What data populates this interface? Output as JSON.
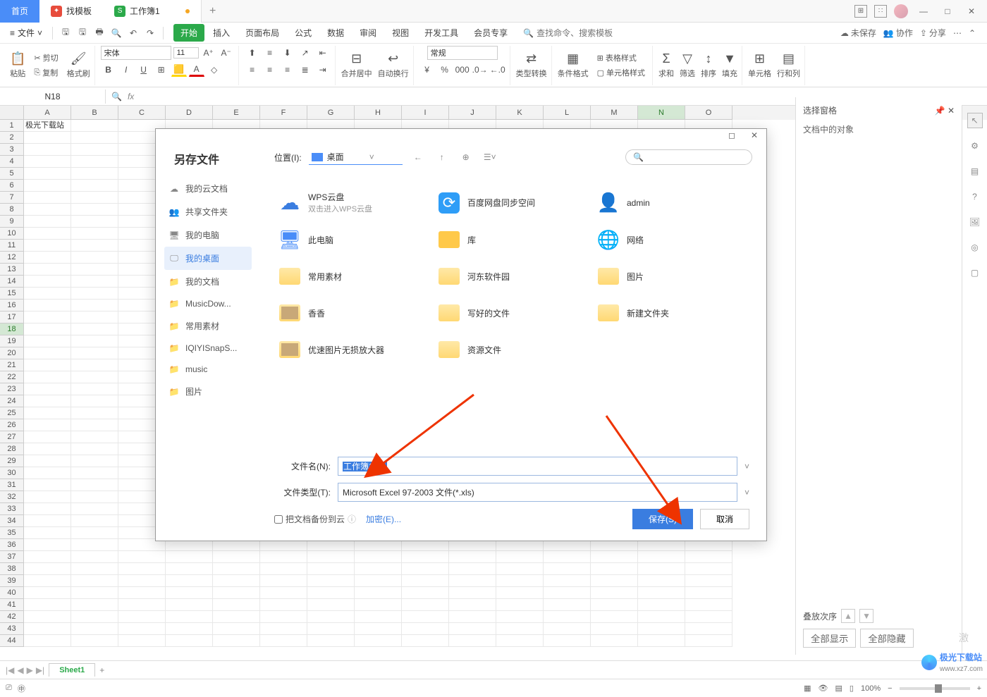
{
  "titleTabs": {
    "home": "首页",
    "template": "找模板",
    "workbook": "工作簿1"
  },
  "menu": {
    "file": "文件",
    "tabs": [
      "开始",
      "插入",
      "页面布局",
      "公式",
      "数据",
      "审阅",
      "视图",
      "开发工具",
      "会员专享"
    ],
    "searchPlaceholder": "查找命令、搜索模板",
    "unsaved": "未保存",
    "coop": "协作",
    "share": "分享"
  },
  "ribbon": {
    "paste": "粘贴",
    "cut": "剪切",
    "copy": "复制",
    "fmtPainter": "格式刷",
    "font": "宋体",
    "fontSize": "11",
    "mergeCenter": "合并居中",
    "wrap": "自动换行",
    "general": "常规",
    "typeConvert": "类型转换",
    "condFmt": "条件格式",
    "tableStyle": "表格样式",
    "cellStyle": "单元格样式",
    "sum": "求和",
    "filter": "筛选",
    "sort": "排序",
    "fill": "填充",
    "cells": "单元格",
    "rowsCols": "行和列"
  },
  "nameBox": "N18",
  "cellA1": "极光下载站",
  "columns": [
    "A",
    "B",
    "C",
    "D",
    "E",
    "F",
    "G",
    "H",
    "I",
    "J",
    "K",
    "L",
    "M",
    "N",
    "O"
  ],
  "activeCol": "N",
  "activeRow": 18,
  "sheetTab": "Sheet1",
  "sidePanel": {
    "title": "选择窗格",
    "objects": "文档中的对象",
    "stack": "叠放次序",
    "showAll": "全部显示",
    "hideAll": "全部隐藏"
  },
  "status": {
    "zoom": "100%"
  },
  "dialog": {
    "title": "另存文件",
    "locationLabel": "位置(I):",
    "locationValue": "桌面",
    "sidebar": [
      "我的云文档",
      "共享文件夹",
      "我的电脑",
      "我的桌面",
      "我的文档",
      "MusicDow...",
      "常用素材",
      "IQIYISnapS...",
      "music",
      "图片"
    ],
    "sidebarActive": 3,
    "files": [
      {
        "name": "WPS云盘",
        "sub": "双击进入WPS云盘",
        "icon": "cloud"
      },
      {
        "name": "百度网盘同步空间",
        "icon": "baidu"
      },
      {
        "name": "admin",
        "icon": "user"
      },
      {
        "name": "此电脑",
        "icon": "pc"
      },
      {
        "name": "库",
        "icon": "lib"
      },
      {
        "name": "网络",
        "icon": "net"
      },
      {
        "name": "常用素材",
        "icon": "folder"
      },
      {
        "name": "河东软件园",
        "icon": "folder"
      },
      {
        "name": "图片",
        "icon": "folder"
      },
      {
        "name": "香香",
        "icon": "folder-img"
      },
      {
        "name": "写好的文件",
        "icon": "folder"
      },
      {
        "name": "新建文件夹",
        "icon": "folder"
      },
      {
        "name": "优速图片无损放大器",
        "icon": "folder-img"
      },
      {
        "name": "资源文件",
        "icon": "folder"
      }
    ],
    "filenameLabel": "文件名(N):",
    "filenameValue": "工作簿1.xls",
    "filetypeLabel": "文件类型(T):",
    "filetypeValue": "Microsoft Excel 97-2003 文件(*.xls)",
    "backupCheck": "把文档备份到云",
    "encrypt": "加密(E)...",
    "save": "保存(S)",
    "cancel": "取消"
  },
  "watermark": {
    "brand": "极光下载站",
    "url": "www.xz7.com"
  },
  "activateHint": "激"
}
